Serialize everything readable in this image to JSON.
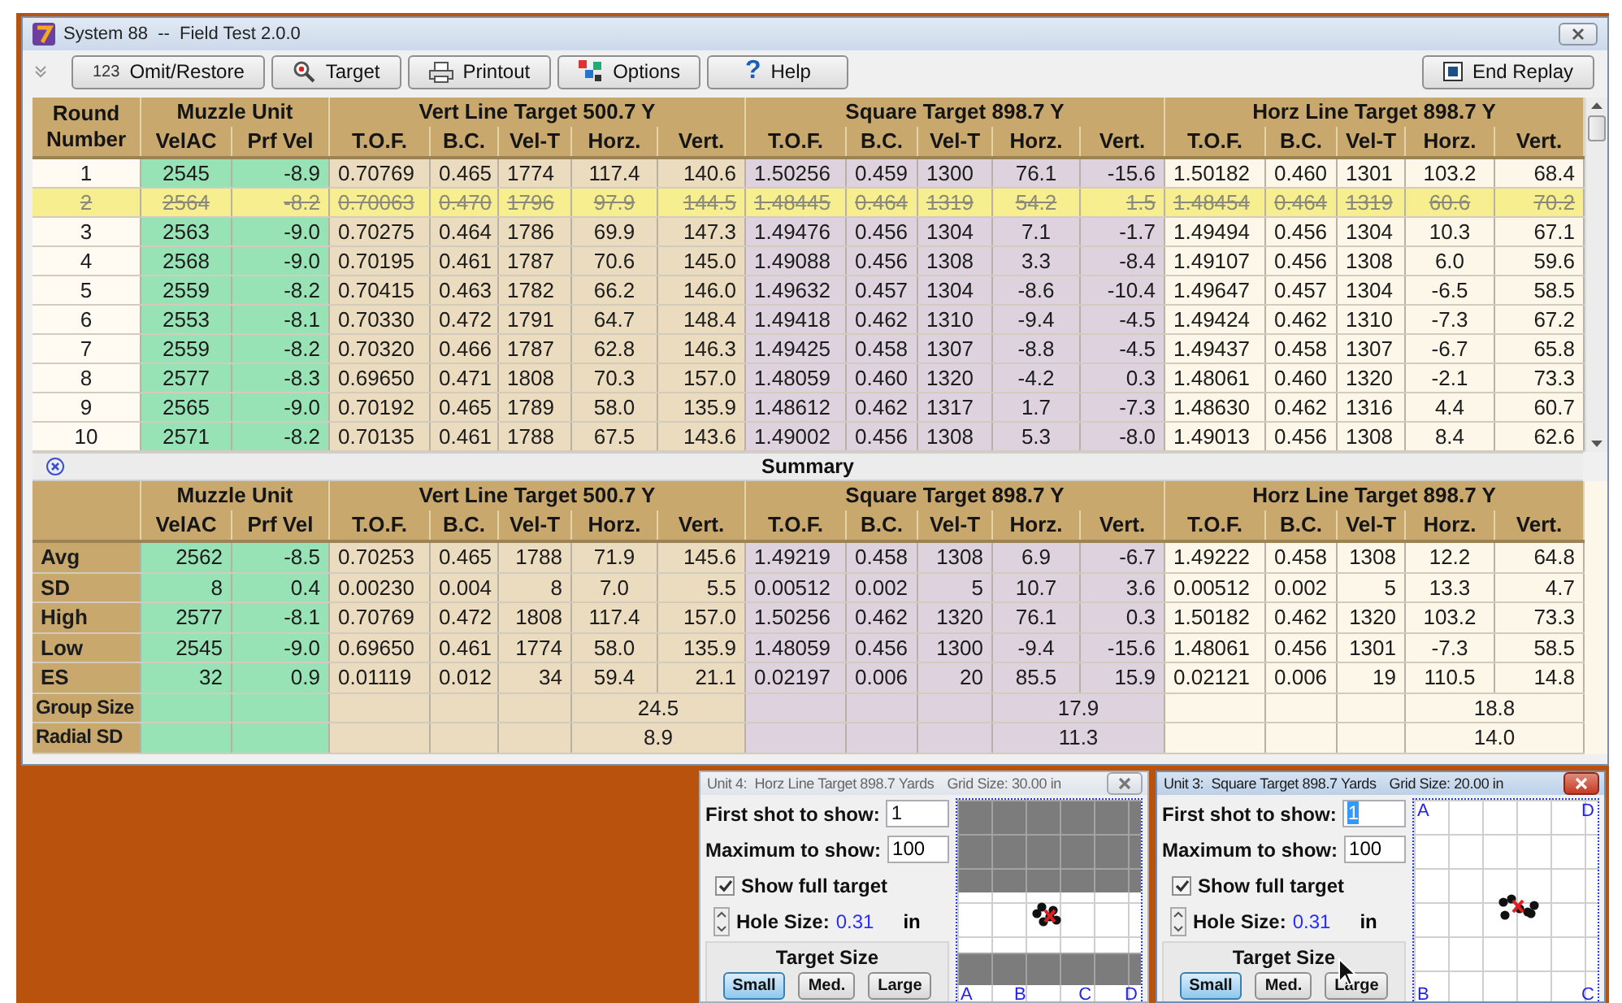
{
  "window": {
    "title": "System 88  --  Field Test 2.0.0"
  },
  "toolbar": [
    {
      "label": "Omit/Restore",
      "icon_text": "123"
    },
    {
      "label": "Target"
    },
    {
      "label": "Printout"
    },
    {
      "label": "Options"
    },
    {
      "label": "Help",
      "icon_text": "?"
    }
  ],
  "end_button": {
    "label": "End Replay"
  },
  "table": {
    "round_header": "Round Number",
    "header_groups": [
      {
        "title": "Muzzle Unit",
        "kind": "muzzle",
        "columns": [
          "VelAC",
          "Prf Vel"
        ]
      },
      {
        "title": "Vert Line Target 500.7 Y",
        "kind": "vert",
        "columns": [
          "T.O.F.",
          "B.C.",
          "Vel-T",
          "Horz.",
          "Vert."
        ]
      },
      {
        "title": "Square Target 898.7 Y",
        "kind": "square",
        "columns": [
          "T.O.F.",
          "B.C.",
          "Vel-T",
          "Horz.",
          "Vert."
        ]
      },
      {
        "title": "Horz Line Target 898.7 Y",
        "kind": "horz",
        "columns": [
          "T.O.F.",
          "B.C.",
          "Vel-T",
          "Horz.",
          "Vert."
        ]
      }
    ],
    "rows": [
      {
        "round": "1",
        "omitted": false,
        "cells": [
          "2545",
          "-8.9",
          "0.70769",
          "0.465",
          "1774",
          "117.4",
          "140.6",
          "1.50256",
          "0.459",
          "1300",
          "76.1",
          "-15.6",
          "1.50182",
          "0.460",
          "1301",
          "103.2",
          "68.4"
        ]
      },
      {
        "round": "2",
        "omitted": true,
        "cells": [
          "2564",
          "-8.2",
          "0.70063",
          "0.470",
          "1796",
          "97.9",
          "144.5",
          "1.48445",
          "0.464",
          "1319",
          "54.2",
          "1.5",
          "1.48454",
          "0.464",
          "1319",
          "60.6",
          "70.2"
        ]
      },
      {
        "round": "3",
        "omitted": false,
        "cells": [
          "2563",
          "-9.0",
          "0.70275",
          "0.464",
          "1786",
          "69.9",
          "147.3",
          "1.49476",
          "0.456",
          "1304",
          "7.1",
          "-1.7",
          "1.49494",
          "0.456",
          "1304",
          "10.3",
          "67.1"
        ]
      },
      {
        "round": "4",
        "omitted": false,
        "cells": [
          "2568",
          "-9.0",
          "0.70195",
          "0.461",
          "1787",
          "70.6",
          "145.0",
          "1.49088",
          "0.456",
          "1308",
          "3.3",
          "-8.4",
          "1.49107",
          "0.456",
          "1308",
          "6.0",
          "59.6"
        ]
      },
      {
        "round": "5",
        "omitted": false,
        "cells": [
          "2559",
          "-8.2",
          "0.70415",
          "0.463",
          "1782",
          "66.2",
          "146.0",
          "1.49632",
          "0.457",
          "1304",
          "-8.6",
          "-10.4",
          "1.49647",
          "0.457",
          "1304",
          "-6.5",
          "58.5"
        ]
      },
      {
        "round": "6",
        "omitted": false,
        "cells": [
          "2553",
          "-8.1",
          "0.70330",
          "0.472",
          "1791",
          "64.7",
          "148.4",
          "1.49418",
          "0.462",
          "1310",
          "-9.4",
          "-4.5",
          "1.49424",
          "0.462",
          "1310",
          "-7.3",
          "67.2"
        ]
      },
      {
        "round": "7",
        "omitted": false,
        "cells": [
          "2559",
          "-8.2",
          "0.70320",
          "0.466",
          "1787",
          "62.8",
          "146.3",
          "1.49425",
          "0.458",
          "1307",
          "-8.8",
          "-4.5",
          "1.49437",
          "0.458",
          "1307",
          "-6.7",
          "65.8"
        ]
      },
      {
        "round": "8",
        "omitted": false,
        "cells": [
          "2577",
          "-8.3",
          "0.69650",
          "0.471",
          "1808",
          "70.3",
          "157.0",
          "1.48059",
          "0.460",
          "1320",
          "-4.2",
          "0.3",
          "1.48061",
          "0.460",
          "1320",
          "-2.1",
          "73.3"
        ]
      },
      {
        "round": "9",
        "omitted": false,
        "cells": [
          "2565",
          "-9.0",
          "0.70192",
          "0.465",
          "1789",
          "58.0",
          "135.9",
          "1.48612",
          "0.462",
          "1317",
          "1.7",
          "-7.3",
          "1.48630",
          "0.462",
          "1316",
          "4.4",
          "60.7"
        ]
      },
      {
        "round": "10",
        "omitted": false,
        "cells": [
          "2571",
          "-8.2",
          "0.70135",
          "0.461",
          "1788",
          "67.5",
          "143.6",
          "1.49002",
          "0.456",
          "1308",
          "5.3",
          "-8.0",
          "1.49013",
          "0.456",
          "1308",
          "8.4",
          "62.6"
        ]
      }
    ]
  },
  "summary": {
    "title": "Summary",
    "header_groups": [
      {
        "title": "Muzzle Unit",
        "kind": "muzzle",
        "columns": [
          "VelAC",
          "Prf Vel"
        ]
      },
      {
        "title": "Vert Line Target 500.7 Y",
        "kind": "vert",
        "columns": [
          "T.O.F.",
          "B.C.",
          "Vel-T",
          "Horz.",
          "Vert."
        ]
      },
      {
        "title": "Square Target 898.7 Y",
        "kind": "square",
        "columns": [
          "T.O.F.",
          "B.C.",
          "Vel-T",
          "Horz.",
          "Vert."
        ]
      },
      {
        "title": "Horz Line Target 898.7 Y",
        "kind": "horz",
        "columns": [
          "T.O.F.",
          "B.C.",
          "Vel-T",
          "Horz.",
          "Vert."
        ]
      }
    ],
    "rows": [
      {
        "label": "Avg",
        "cells": [
          "2562",
          "-8.5",
          "0.70253",
          "0.465",
          "1788",
          "71.9",
          "145.6",
          "1.49219",
          "0.458",
          "1308",
          "6.9",
          "-6.7",
          "1.49222",
          "0.458",
          "1308",
          "12.2",
          "64.8"
        ]
      },
      {
        "label": "SD",
        "cells": [
          "8",
          "0.4",
          "0.00230",
          "0.004",
          "8",
          "7.0",
          "5.5",
          "0.00512",
          "0.002",
          "5",
          "10.7",
          "3.6",
          "0.00512",
          "0.002",
          "5",
          "13.3",
          "4.7"
        ]
      },
      {
        "label": "High",
        "cells": [
          "2577",
          "-8.1",
          "0.70769",
          "0.472",
          "1808",
          "117.4",
          "157.0",
          "1.50256",
          "0.462",
          "1320",
          "76.1",
          "0.3",
          "1.50182",
          "0.462",
          "1320",
          "103.2",
          "73.3"
        ]
      },
      {
        "label": "Low",
        "cells": [
          "2545",
          "-9.0",
          "0.69650",
          "0.461",
          "1774",
          "58.0",
          "135.9",
          "1.48059",
          "0.456",
          "1300",
          "-9.4",
          "-15.6",
          "1.48061",
          "0.456",
          "1301",
          "-7.3",
          "58.5"
        ]
      },
      {
        "label": "ES",
        "cells": [
          "32",
          "0.9",
          "0.01119",
          "0.012",
          "34",
          "59.4",
          "21.1",
          "0.02197",
          "0.006",
          "20",
          "85.5",
          "15.9",
          "0.02121",
          "0.006",
          "19",
          "110.5",
          "14.8"
        ]
      }
    ],
    "merged_rows": [
      {
        "label": "Group Size",
        "values": [
          "24.5",
          "17.9",
          "18.8"
        ]
      },
      {
        "label": "Radial SD",
        "values": [
          "8.9",
          "11.3",
          "14.0"
        ]
      }
    ]
  },
  "target_windows": [
    {
      "title": "Unit 4:  Horz Line Target 898.7 Yards",
      "grid_size": "Grid Size: 30.00 in",
      "active": false,
      "first_label": "First shot to show:",
      "first_value": "1",
      "first_value_selected": false,
      "max_label": "Maximum to show:",
      "max_value": "100",
      "show_full": {
        "label": "Show full target",
        "checked": true
      },
      "hole_label": "Hole Size:",
      "hole_value": "0.31",
      "hole_unit": "in",
      "size_title": "Target Size",
      "sizes": [
        {
          "label": "Small",
          "selected": true
        },
        {
          "label": "Med.",
          "selected": false
        },
        {
          "label": "Large",
          "selected": false
        }
      ],
      "pointer": false,
      "target": {
        "kind": "horz_line",
        "corners": [
          "A",
          "B",
          "C",
          "D"
        ]
      }
    },
    {
      "title": "Unit 3:  Square Target 898.7 Yards",
      "grid_size": "Grid Size: 20.00 in",
      "active": true,
      "first_label": "First shot to show:",
      "first_value": "1",
      "first_value_selected": true,
      "max_label": "Maximum to show:",
      "max_value": "100",
      "show_full": {
        "label": "Show full target",
        "checked": true
      },
      "hole_label": "Hole Size:",
      "hole_value": "0.31",
      "hole_unit": "in",
      "size_title": "Target Size",
      "sizes": [
        {
          "label": "Small",
          "selected": true
        },
        {
          "label": "Med.",
          "selected": false
        },
        {
          "label": "Large",
          "selected": false
        }
      ],
      "pointer": true,
      "target": {
        "kind": "square",
        "corners": [
          "A",
          "D",
          "B",
          "C"
        ]
      }
    }
  ]
}
